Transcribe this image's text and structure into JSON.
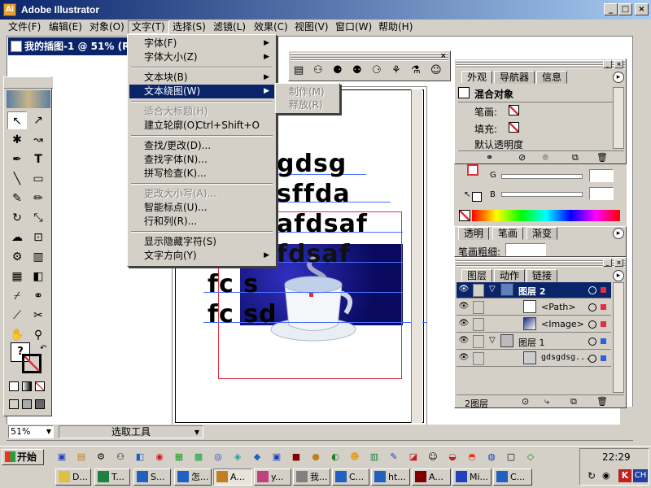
{
  "window": {
    "title": "Adobe Illustrator",
    "icon": "illustrator-app-icon"
  },
  "caption_buttons": {
    "minimize": "_",
    "maximize": "□",
    "close": "×"
  },
  "menubar": [
    {
      "label": "文件(F)"
    },
    {
      "label": "编辑(E)"
    },
    {
      "label": "对象(O)"
    },
    {
      "label": "文字(T)"
    },
    {
      "label": "选择(S)"
    },
    {
      "label": "滤镜(L)"
    },
    {
      "label": "效果(C)"
    },
    {
      "label": "视图(V)"
    },
    {
      "label": "窗口(W)"
    },
    {
      "label": "帮助(H)"
    }
  ],
  "document": {
    "title": "我的插图-1 @ 51% (R"
  },
  "text_menu": {
    "items": [
      {
        "label": "字体(F)"
      },
      {
        "label": "字体大小(Z)"
      },
      {
        "label": "文本块(B)"
      },
      {
        "label": "文本绕图(W)"
      },
      {
        "label": "适合大标题(H)"
      },
      {
        "label": "建立轮廓(O)",
        "shortcut": "Ctrl+Shift+O"
      },
      {
        "label": "查找/更改(D)..."
      },
      {
        "label": "查找字体(N)..."
      },
      {
        "label": "拼写检查(K)..."
      },
      {
        "label": "更改大小写(A)..."
      },
      {
        "label": "智能标点(U)..."
      },
      {
        "label": "行和列(R)..."
      },
      {
        "label": "显示隐藏字符(S)"
      },
      {
        "label": "文字方向(Y)"
      }
    ]
  },
  "wrap_submenu": {
    "items": [
      {
        "label": "制作(M)"
      },
      {
        "label": "释放(R)"
      }
    ]
  },
  "appearance_panel": {
    "tabs": [
      "外观",
      "导航器",
      "信息"
    ],
    "title": "混合对象",
    "stroke_label": "笔画:",
    "fill_label": "填充:",
    "opacity_label": "默认透明度"
  },
  "color_panel": {
    "g_label": "G",
    "b_label": "B"
  },
  "stroke_panel": {
    "tabs": [
      "透明",
      "笔画",
      "渐变"
    ],
    "weight_label": "笔画粗细:"
  },
  "layers_panel": {
    "tabs": [
      "图层",
      "动作",
      "链接"
    ],
    "rows": [
      {
        "label": "图层 2"
      },
      {
        "label": "<Path>"
      },
      {
        "label": "<Image>"
      },
      {
        "label": "图层 1"
      },
      {
        "label": "gdsgdsg..."
      }
    ],
    "footer": "2图层"
  },
  "artwork": {
    "lines": [
      "gdsg",
      "sffda",
      "afdsaf",
      "fdsaf",
      "fc s",
      "fc sd"
    ]
  },
  "status": {
    "zoom": "51%",
    "tool": "选取工具"
  },
  "taskbar": {
    "start": "开始",
    "clock": "22:29",
    "ime": "CH",
    "tasks": [
      {
        "label": "D..."
      },
      {
        "label": "T..."
      },
      {
        "label": "S..."
      },
      {
        "label": "怎..."
      },
      {
        "label": "A..."
      },
      {
        "label": "y..."
      },
      {
        "label": "我..."
      },
      {
        "label": "C..."
      },
      {
        "label": "ht..."
      },
      {
        "label": "A..."
      },
      {
        "label": "Mi..."
      },
      {
        "label": "C..."
      }
    ]
  },
  "colors": {
    "titlebar": "#0a246a",
    "highlight": "#0a246a",
    "chrome": "#d4d0c8",
    "selection_red": "#e03040"
  }
}
